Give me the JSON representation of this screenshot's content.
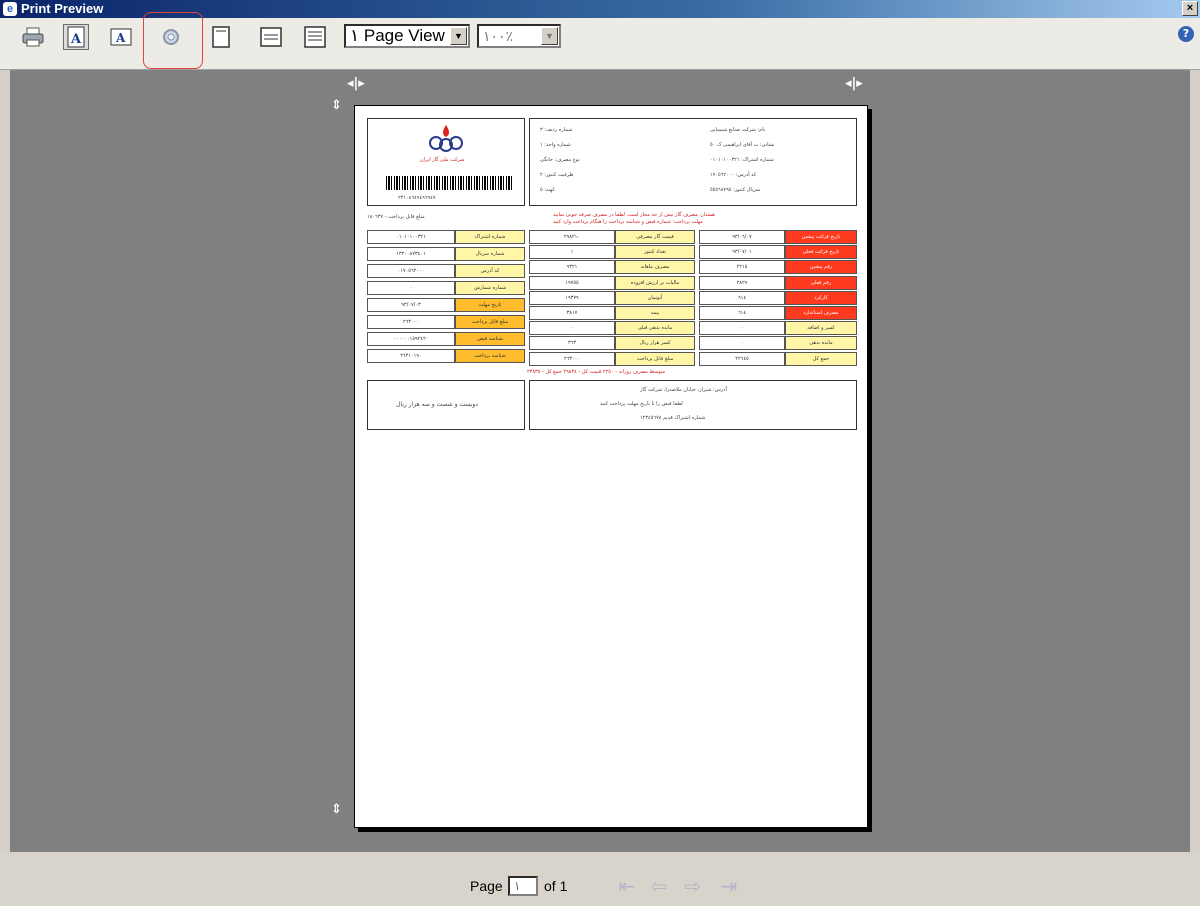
{
  "window": {
    "title": "Print Preview",
    "close": "×"
  },
  "toolbar": {
    "icons": [
      "printer-icon",
      "portrait-icon",
      "landscape-icon",
      "page-setup-icon",
      "one-page-icon",
      "page-width-icon",
      "multi-page-icon"
    ],
    "view_select": "١ Page View",
    "zoom_select": "١٠٠٪",
    "help": "?"
  },
  "invoice": {
    "company": "شرکت ملی گاز ایران",
    "barcode_no": "٢٣١٠٤٦٤٩٤٩٦٩٤٧",
    "sub_note": "مبلغ قابل پرداخت - ١٨٠٦٣٧",
    "left_block": [
      [
        "نام: شرکت صنایع شیمیایی",
        "شماره ردیف: ٣"
      ],
      [
        "نشانی: ب آقای ابراهیمی ک ٥٠",
        "شماره واحد: ١"
      ],
      [
        "شماره اشتراک: ٠١٠١٠١٠٠٣٢١",
        "نوع مصرف: خانگی"
      ],
      [
        "کد آدرس: ١٧٠٥٦٢٠٠٠",
        "ظرفیت کنتور: ٢"
      ],
      [
        "سریال کنتور: ٥٥٥٦٨٧٩٥",
        "کهنه: ٥"
      ]
    ],
    "note1": "هشدار: مصرف گاز بیش از حد مجاز است. لطفا در مصرف صرفه جویی نمایید",
    "note2": "مهلت پرداخت: شماره قبض و شناسه پرداخت را هنگام پرداخت وارد کنید",
    "right_rows": [
      [
        "شماره اشتراک",
        "٠١٠١٠١٠٠٣٢١"
      ],
      [
        "شماره سریال",
        "١٣٢٠٠٨٧٣٤٠١"
      ],
      [
        "کد آدرس",
        "٠١٧٠٥٦٢٠٠٠"
      ],
      [
        "شماره شمارش",
        "٠"
      ],
      [
        "تاریخ مهلت",
        "٩٣/٠٧/٠٣"
      ],
      [
        "مبلغ قابل پرداخت",
        "٢٦٣٠٠٠"
      ],
      [
        "شناسه قبض",
        "٠٠٠٠٠٠١٥٩٢٤٢٠"
      ],
      [
        "شناسه پرداخت",
        "٢٦٣١٠١٩٠"
      ]
    ],
    "mid_rows": [
      [
        "قیمت گاز مصرفی",
        "٢٩٨٢١٠"
      ],
      [
        "تعداد کنتور",
        "١"
      ],
      [
        "مصرف ماهانه",
        "٩٣٢١"
      ],
      [
        "مالیات بر ارزش افزوده",
        "١٩٧٥٥"
      ],
      [
        "آبونمان",
        "١٩٣٧٩"
      ],
      [
        "بیمه",
        "٣٨١٧"
      ],
      [
        "مانده بدهی قبلی",
        "٠"
      ],
      [
        "کسر هزار ریال",
        "٣٦٣"
      ],
      [
        "مبلغ قابل پرداخت",
        "٢٦٣٠٠٠"
      ]
    ],
    "far_rows": [
      [
        "تاریخ قرائت پیشین",
        "٩٣/٠٦/٠٧"
      ],
      [
        "تاریخ قرائت فعلی",
        "٩٣/٠٧/٠١"
      ],
      [
        "رقم پیشین",
        "٢٢١٥"
      ],
      [
        "رقم فعلی",
        "٢٨٢٩"
      ],
      [
        "کارکرد",
        "٦١٤"
      ],
      [
        "مصرف استاندارد",
        "٦١٤"
      ],
      [
        "کسر و اضافه",
        "٠"
      ],
      [
        "مانده بدهی",
        "٠"
      ],
      [
        "جمع کل",
        "٢٢٦٤٥"
      ]
    ],
    "summary_line": "متوسط مصرف روزانه - ٢٢٥٠    قیمت کل - ٢٩٨٣٤    جمع کل - ٢٣٨٣٥",
    "footer_left": "دویست و شصت و سه هزار ریال",
    "footer_right_1": "آدرس: شیراز، خیابان ملاصدرا، شرکت گاز",
    "footer_right_2": "لطفا قبض را تا تاریخ مهلت پرداخت کنید",
    "footer_right_3": "شماره اشتراک قدیم ١٢٣٤٥٦٧٨"
  },
  "status": {
    "page_label": "Page",
    "page_value": "١",
    "of_label": "of 1"
  },
  "nav_icons": [
    "first-page-icon",
    "prev-page-icon",
    "next-page-icon",
    "last-page-icon"
  ]
}
